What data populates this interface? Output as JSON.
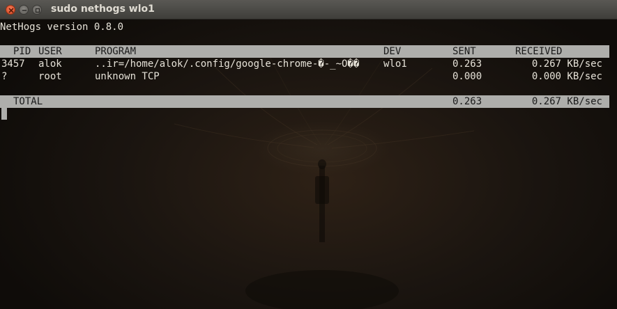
{
  "window": {
    "title": "sudo nethogs wlo1"
  },
  "terminal": {
    "version_line": "NetHogs version 0.8.0",
    "header": {
      "pid": "PID",
      "user": "USER",
      "program": "PROGRAM",
      "dev": "DEV",
      "sent": "SENT",
      "received": "RECEIVED"
    },
    "rows": [
      {
        "pid": "3457",
        "user": "alok",
        "program": "..ir=/home/alok/.config/google-chrome-�-_~O��",
        "dev": "wlo1",
        "sent": "0.263",
        "received": "0.267 KB/sec"
      },
      {
        "pid": "?",
        "user": "root",
        "program": "unknown TCP",
        "dev": "",
        "sent": "0.000",
        "received": "0.000 KB/sec"
      }
    ],
    "total": {
      "label": "TOTAL",
      "sent": "0.263",
      "received": "0.267 KB/sec"
    }
  },
  "colors": {
    "close_button": "#e05a32",
    "header_bar": "#aeaeab",
    "terminal_text": "#e6e2d8"
  },
  "icons": {
    "close": "close-icon",
    "minimize": "minimize-icon",
    "maximize": "maximize-icon"
  }
}
